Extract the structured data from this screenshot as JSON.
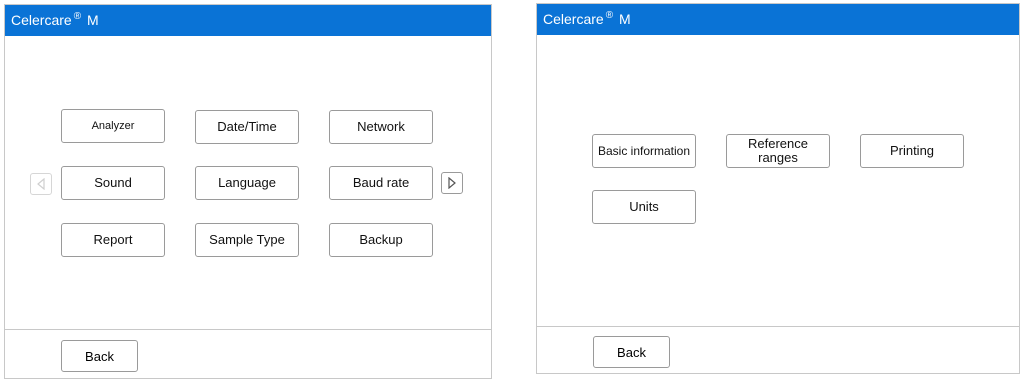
{
  "left_screen": {
    "title": {
      "brand": "Celercare",
      "reg": "®",
      "model": "M"
    },
    "buttons": {
      "analyzer": "Analyzer",
      "datetime": "Date/Time",
      "network": "Network",
      "sound": "Sound",
      "language": "Language",
      "baud_rate": "Baud rate",
      "report": "Report",
      "sample_type": "Sample Type",
      "backup": "Backup"
    },
    "back": "Back"
  },
  "right_screen": {
    "title": {
      "brand": "Celercare",
      "reg": "®",
      "model": "M"
    },
    "buttons": {
      "basic_information": "Basic information",
      "reference_ranges": "Reference ranges",
      "printing": "Printing",
      "units": "Units"
    },
    "back": "Back"
  },
  "colors": {
    "titlebar": "#0a73d6",
    "border": "#9a9a9a"
  },
  "icons": {
    "prev": "left-triangle-arrow-icon",
    "next": "right-triangle-arrow-icon"
  }
}
